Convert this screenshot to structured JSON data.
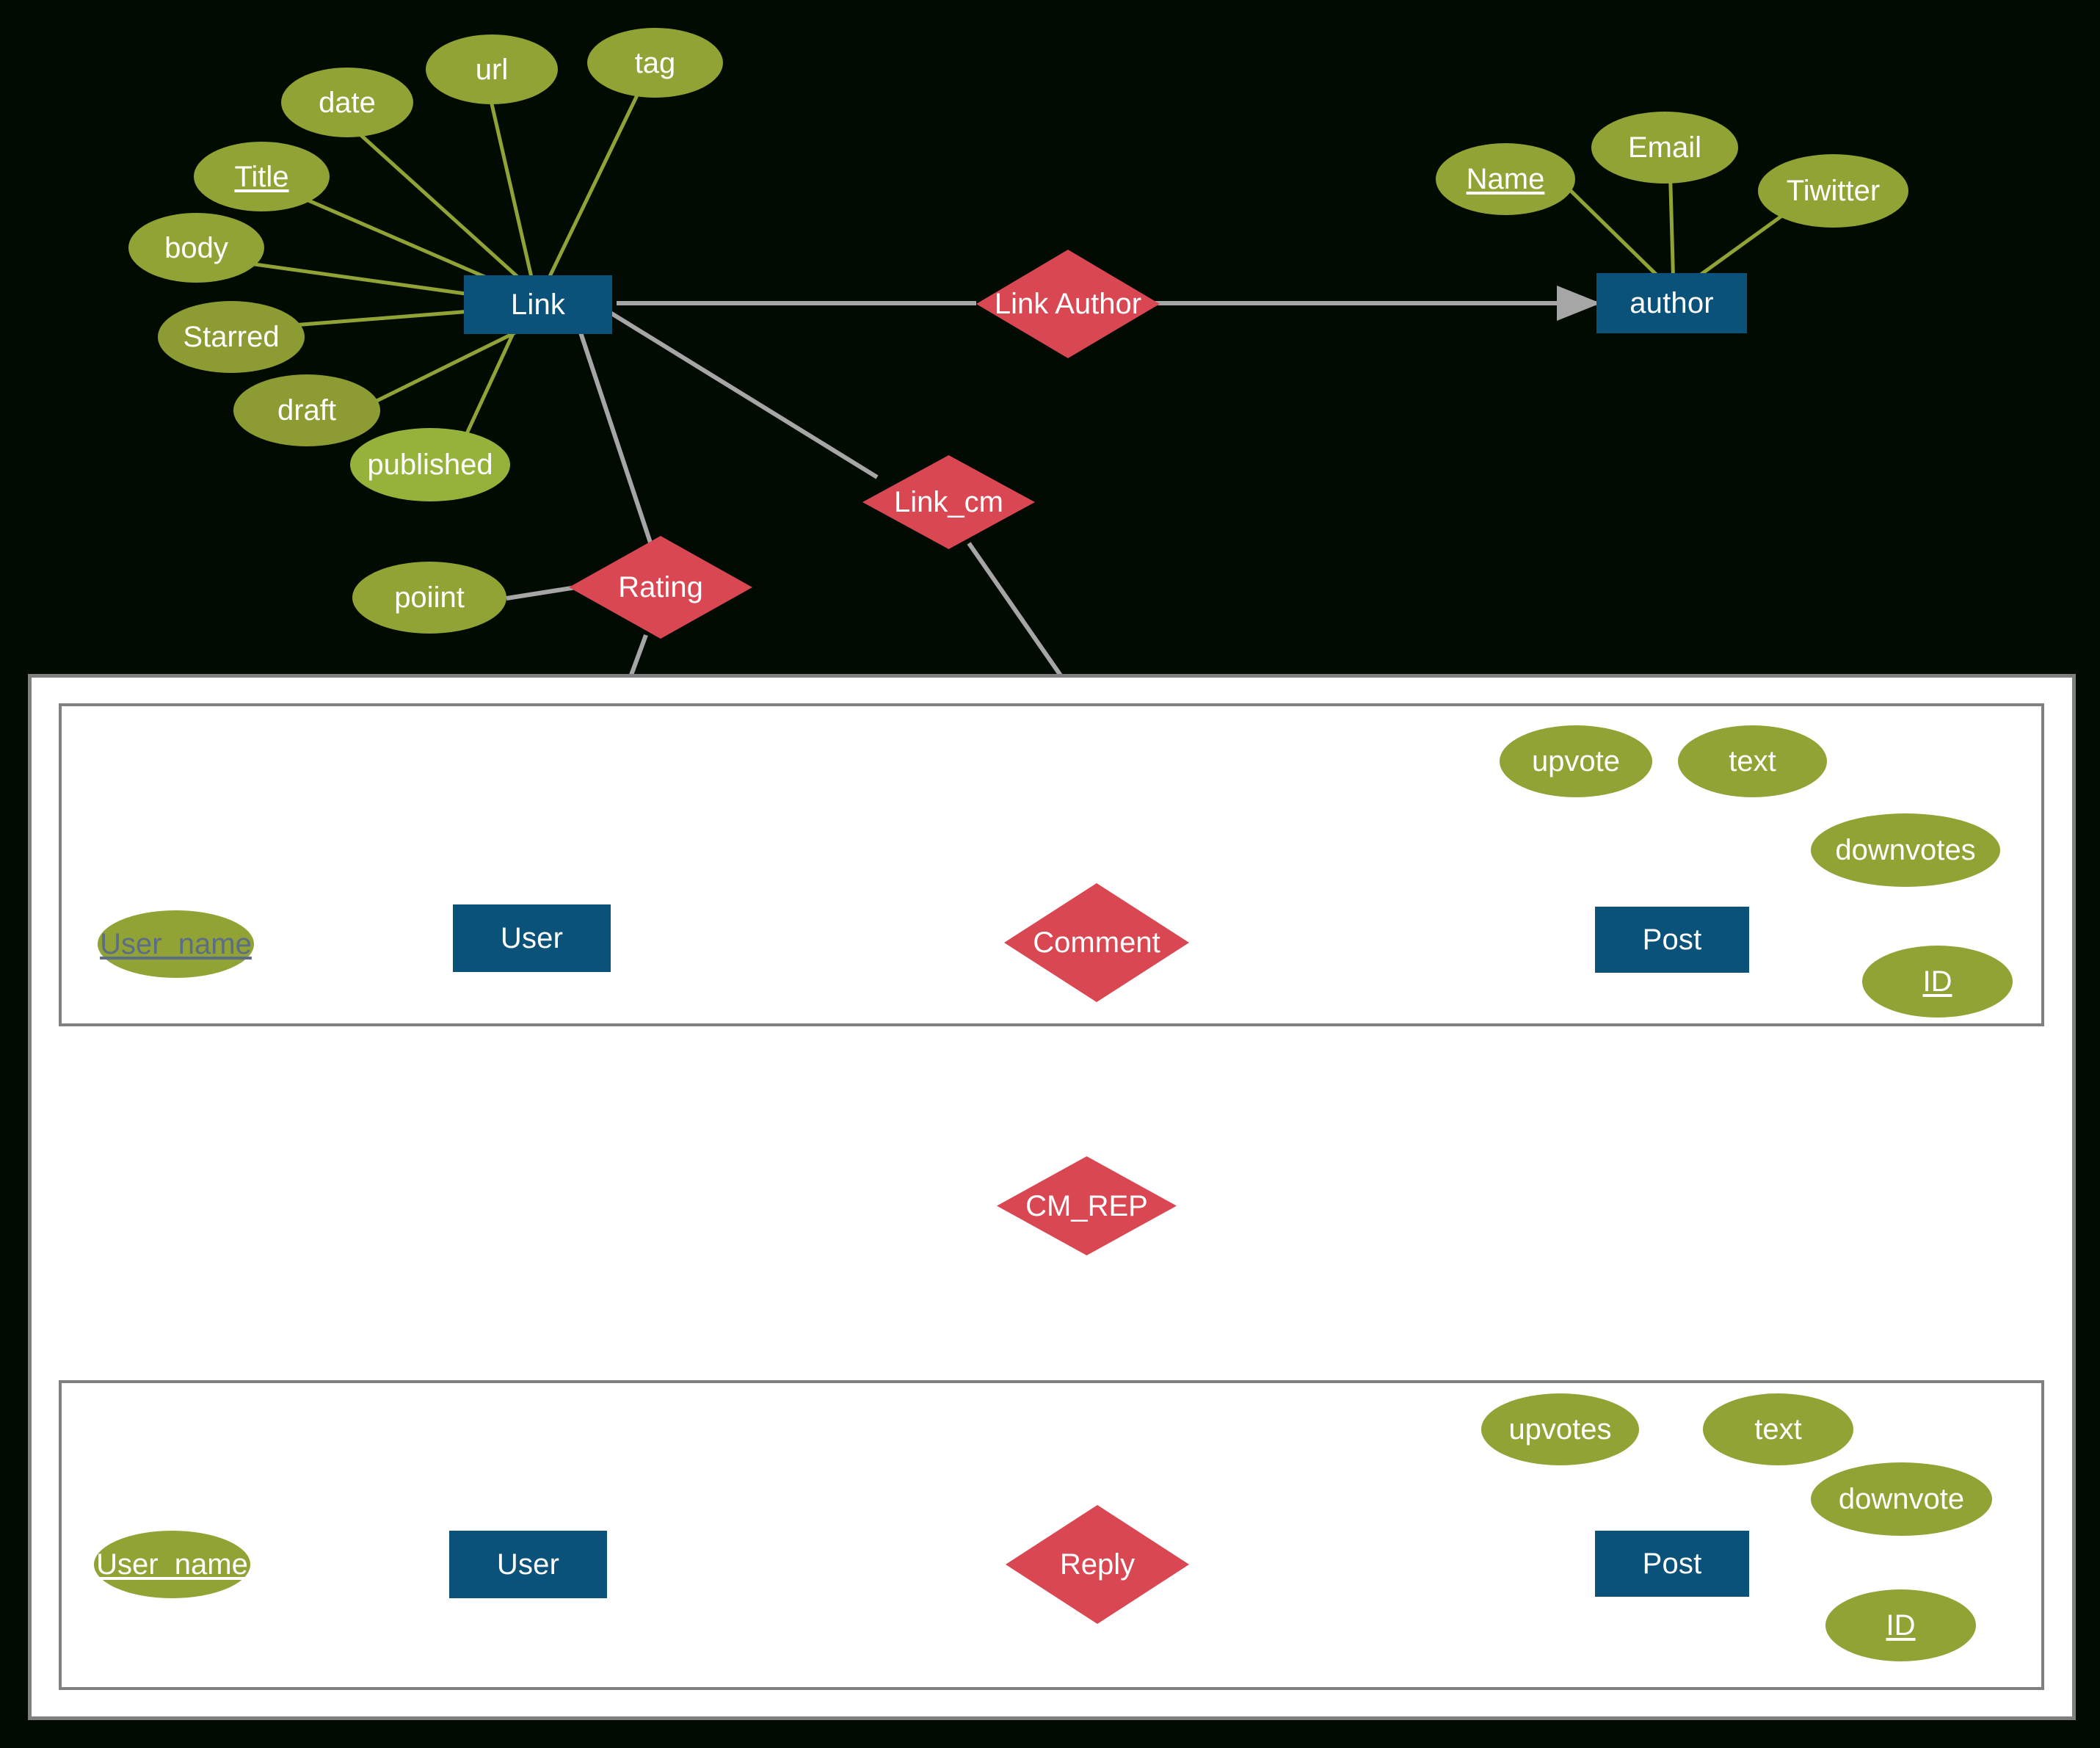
{
  "diagram": {
    "title": "ER Diagram",
    "colors": {
      "background": "#010b02",
      "entity": "#0a5279",
      "attribute": "#90a334",
      "relationship": "#d94753",
      "edge_gray": "#a6a6a6",
      "edge_green": "#90a334",
      "edge_orange": "#d4865c",
      "panel_border": "#808080",
      "panel_fill": "#ffffff"
    }
  },
  "top_section": {
    "entities": [
      {
        "id": "link",
        "label": "Link"
      },
      {
        "id": "author",
        "label": "author"
      }
    ],
    "relationships": [
      {
        "id": "link_author",
        "label": "Link Author"
      },
      {
        "id": "link_cm",
        "label": "Link_cm"
      },
      {
        "id": "rating",
        "label": "Rating"
      }
    ],
    "link_attributes": [
      {
        "label": "date",
        "key": false
      },
      {
        "label": "url",
        "key": false
      },
      {
        "label": "tag",
        "key": false
      },
      {
        "label": "Title",
        "key": true
      },
      {
        "label": "body",
        "key": false
      },
      {
        "label": "Starred",
        "key": false
      },
      {
        "label": "draft",
        "key": false
      },
      {
        "label": "published",
        "key": false
      }
    ],
    "author_attributes": [
      {
        "label": "Name",
        "key": true
      },
      {
        "label": "Email",
        "key": false
      },
      {
        "label": "Tiwitter",
        "key": false
      }
    ],
    "rating_attributes": [
      {
        "label": "poiint",
        "key": false
      }
    ]
  },
  "comment_box": {
    "entities": [
      {
        "id": "user",
        "label": "User"
      },
      {
        "id": "post",
        "label": "Post"
      }
    ],
    "relationship": {
      "id": "comment",
      "label": "Comment"
    },
    "user_attributes": [
      {
        "label": "User_name",
        "key": true
      }
    ],
    "post_attributes": [
      {
        "label": "upvote",
        "key": false
      },
      {
        "label": "text",
        "key": false
      },
      {
        "label": "downvotes",
        "key": false
      },
      {
        "label": "ID",
        "key": true
      }
    ]
  },
  "bridge": {
    "relationship": {
      "id": "cm_rep",
      "label": "CM_REP"
    }
  },
  "reply_box": {
    "entities": [
      {
        "id": "user",
        "label": "User"
      },
      {
        "id": "post",
        "label": "Post"
      }
    ],
    "relationship": {
      "id": "reply",
      "label": "Reply"
    },
    "user_attributes": [
      {
        "label": "User_name",
        "key": true
      }
    ],
    "post_attributes": [
      {
        "label": "upvotes",
        "key": false
      },
      {
        "label": "text",
        "key": false
      },
      {
        "label": "downvote",
        "key": false
      },
      {
        "label": "ID",
        "key": true
      }
    ]
  }
}
